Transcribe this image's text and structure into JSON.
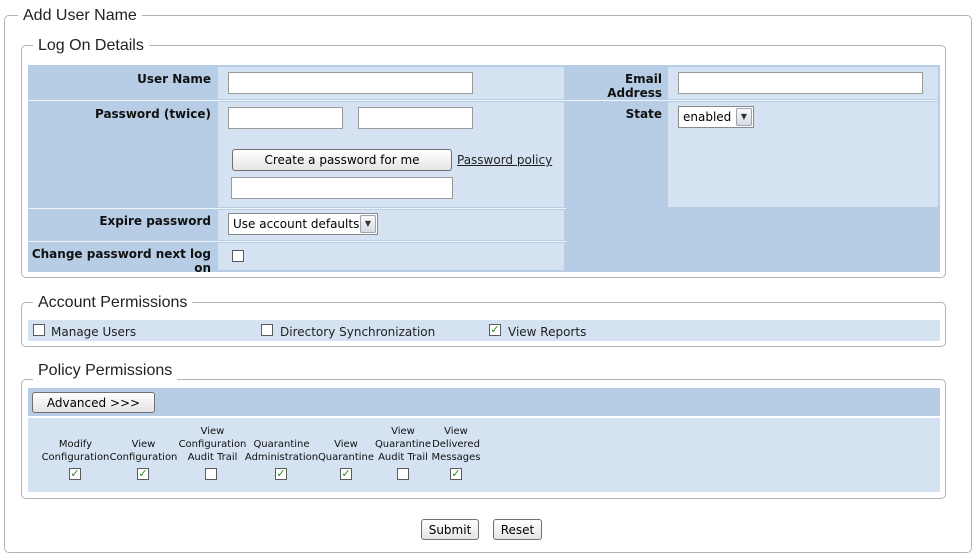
{
  "page_title": "Add User Name",
  "logon": {
    "legend": "Log On Details",
    "user_name_label": "User Name",
    "user_name_value": "",
    "password_label": "Password (twice)",
    "password1_value": "",
    "password2_value": "",
    "create_password_label": "Create a password for me",
    "password_policy_label": "Password policy",
    "generated_password_value": "",
    "expire_label": "Expire password",
    "expire_selected": "Use account defaults",
    "change_next_label": "Change password next log on",
    "change_next_checked": false,
    "email_label": "Email Address",
    "email_value": "",
    "state_label": "State",
    "state_selected": "enabled"
  },
  "account_permissions": {
    "legend": "Account Permissions",
    "items": [
      {
        "label": "Manage Users",
        "checked": false
      },
      {
        "label": "Directory Synchronization",
        "checked": false
      },
      {
        "label": "View Reports",
        "checked": true
      }
    ]
  },
  "policy_permissions": {
    "legend": "Policy Permissions",
    "advanced_label": "Advanced >>>",
    "items": [
      {
        "label": "Modify\nConfiguration",
        "checked": true
      },
      {
        "label": "View\nConfiguration",
        "checked": true
      },
      {
        "label": "View\nConfiguration\nAudit Trail",
        "checked": false
      },
      {
        "label": "Quarantine\nAdministration",
        "checked": true
      },
      {
        "label": "View\nQuarantine",
        "checked": true
      },
      {
        "label": "View\nQuarantine\nAudit Trail",
        "checked": false
      },
      {
        "label": "View\nDelivered\nMessages",
        "checked": true
      }
    ]
  },
  "actions": {
    "submit_label": "Submit",
    "reset_label": "Reset"
  },
  "colors": {
    "panel_dark": "#b7cde6",
    "panel_light": "#d4e2f2",
    "check_mark": "#2a8a2a"
  }
}
